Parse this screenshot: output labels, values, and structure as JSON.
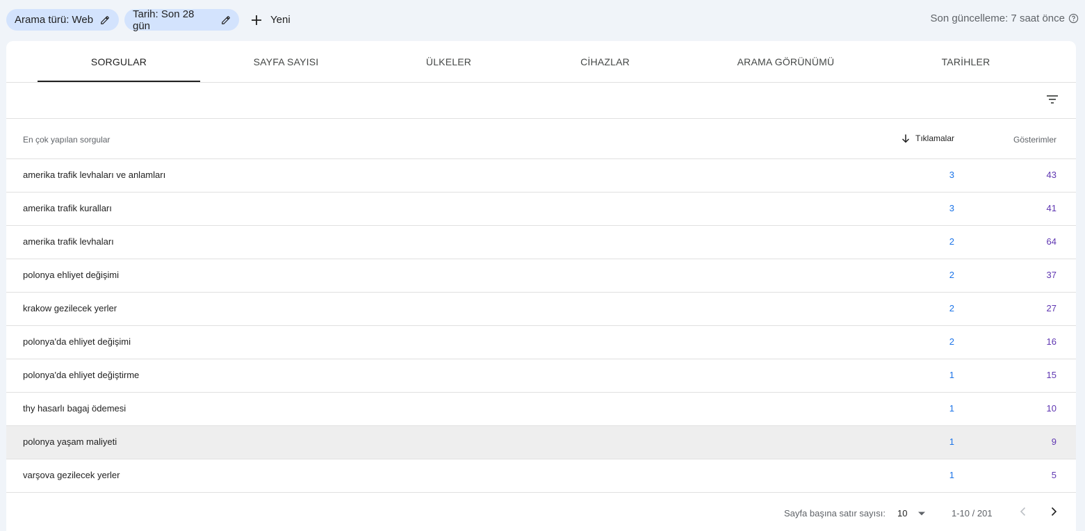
{
  "filters": {
    "search_type": "Arama türü: Web",
    "date": "Tarih: Son 28 gün",
    "new_label": "Yeni"
  },
  "last_updated": "Son güncelleme: 7 saat önce",
  "tabs": [
    {
      "label": "SORGULAR",
      "active": true
    },
    {
      "label": "SAYFA SAYISI",
      "active": false
    },
    {
      "label": "ÜLKELER",
      "active": false
    },
    {
      "label": "CİHAZLAR",
      "active": false
    },
    {
      "label": "ARAMA GÖRÜNÜMÜ",
      "active": false
    },
    {
      "label": "TARİHLER",
      "active": false
    }
  ],
  "table": {
    "headers": {
      "query": "En çok yapılan sorgular",
      "clicks": "Tıklamalar",
      "impressions": "Gösterimler"
    },
    "sort_icon": "arrow-down-icon",
    "rows": [
      {
        "query": "amerika trafik levhaları ve anlamları",
        "clicks": "3",
        "impressions": "43"
      },
      {
        "query": "amerika trafik kuralları",
        "clicks": "3",
        "impressions": "41"
      },
      {
        "query": "amerika trafik levhaları",
        "clicks": "2",
        "impressions": "64"
      },
      {
        "query": "polonya ehliyet değişimi",
        "clicks": "2",
        "impressions": "37"
      },
      {
        "query": "krakow gezilecek yerler",
        "clicks": "2",
        "impressions": "27"
      },
      {
        "query": "polonya'da ehliyet değişimi",
        "clicks": "2",
        "impressions": "16"
      },
      {
        "query": "polonya'da ehliyet değiştirme",
        "clicks": "1",
        "impressions": "15"
      },
      {
        "query": "thy hasarlı bagaj ödemesi",
        "clicks": "1",
        "impressions": "10"
      },
      {
        "query": "polonya yaşam maliyeti",
        "clicks": "1",
        "impressions": "9"
      },
      {
        "query": "varşova gezilecek yerler",
        "clicks": "1",
        "impressions": "5"
      }
    ]
  },
  "pagination": {
    "rows_per_page_label": "Sayfa başına satır sayısı:",
    "rows_per_page_value": "10",
    "range": "1-10 / 201"
  },
  "colors": {
    "chip_bg": "#d3e3fd",
    "clicks": "#1a73e8",
    "impressions": "#5e35b1",
    "page_bg": "#f0f4f9"
  }
}
